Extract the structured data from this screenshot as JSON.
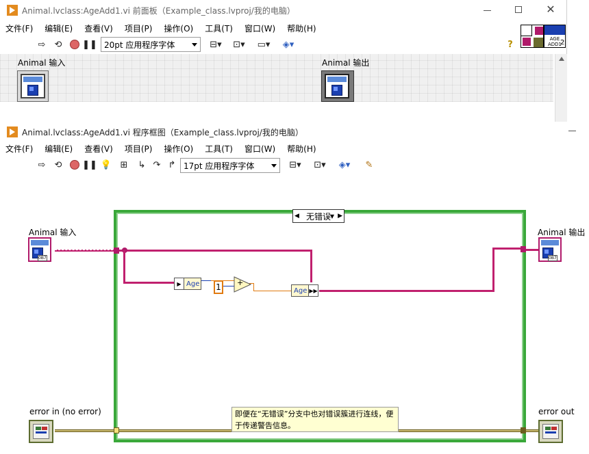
{
  "front_panel": {
    "title": "Animal.lvclass:AgeAdd1.vi 前面板（Example_class.lvproj/我的电脑）",
    "menu": [
      "文件(F)",
      "编辑(E)",
      "查看(V)",
      "项目(P)",
      "操作(O)",
      "工具(T)",
      "窗口(W)",
      "帮助(H)"
    ],
    "font": "20pt 应用程序字体",
    "connector_label": "AGE ADD1",
    "connector_num": "2",
    "controls": {
      "input_label": "Animal 输入",
      "output_label": "Animal 输出"
    }
  },
  "block_diagram": {
    "title": "Animal.lvclass:AgeAdd1.vi 程序框图（Example_class.lvproj/我的电脑）",
    "menu": [
      "文件(F)",
      "编辑(E)",
      "查看(V)",
      "项目(P)",
      "操作(O)",
      "工具(T)",
      "窗口(W)",
      "帮助(H)"
    ],
    "font": "17pt 应用程序字体",
    "case_selector": "无错误",
    "terminals": {
      "animal_in": "Animal 输入",
      "animal_out": "Animal 输出",
      "error_in": "error in (no error)",
      "error_out": "error out"
    },
    "unbundle_label": "Age",
    "bundle_label": "Age",
    "constant": "1",
    "add_symbol": "+",
    "obj_tag": "0B7",
    "note": "即便在“无错误”分支中也对错误簇进行连线，便于传递警告信息。"
  },
  "colors": {
    "object_wire": "#c0206e",
    "numeric_wire": "#e07a10",
    "error_wire": "#6b5e1e",
    "case_border": "#3aa83a"
  }
}
